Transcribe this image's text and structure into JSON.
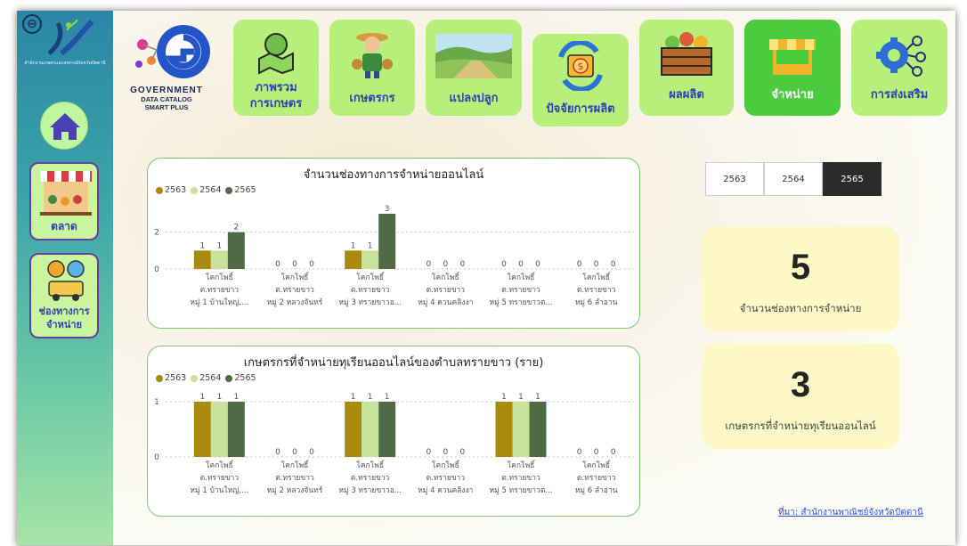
{
  "sidebar": {
    "back_label": "⊖",
    "org_name": "สำนักงานเกษตรและสหกรณ์จังหวัดปัตตานี",
    "items": [
      {
        "label": "ตลาด"
      },
      {
        "label": "ช่องทางการ\nจำหน่าย"
      }
    ]
  },
  "brand": {
    "line1": "GOVERNMENT",
    "line2": "DATA CATALOG",
    "line3": "SMART PLUS"
  },
  "nav": {
    "tiles": [
      {
        "label": "ภาพรวม\nการเกษตร",
        "icon": "farm-map-icon"
      },
      {
        "label": "เกษตรกร",
        "icon": "farmer-icon"
      },
      {
        "label": "แปลงปลูก",
        "icon": "field-icon"
      },
      {
        "label": "ปัจจัยการผลิต",
        "icon": "money-cycle-icon"
      },
      {
        "label": "ผลผลิต",
        "icon": "produce-crate-icon"
      },
      {
        "label": "จำหน่าย",
        "icon": "market-stall-icon",
        "active": true
      },
      {
        "label": "การส่งเสริม",
        "icon": "gear-network-icon"
      }
    ]
  },
  "slicer": {
    "years": [
      "2563",
      "2564",
      "2565"
    ],
    "selected": "2565"
  },
  "kpis": [
    {
      "value": "5",
      "caption": "จำนวนช่องทางการจำหน่าย"
    },
    {
      "value": "3",
      "caption": "เกษตรกรที่จำหน่ายทุเรียนออนไลน์"
    }
  ],
  "source": {
    "prefix": "ที่มา:",
    "text": "สำนักงานพาณิชย์จังหวัดปัตตานี"
  },
  "colors": {
    "s2563": "#a98a0d",
    "s2564": "#c7e29a",
    "s2565": "#4e6b46",
    "nav_tile": "#b6f07a",
    "nav_active": "#4bcb3e",
    "nav_text": "#2d3fb5"
  },
  "chart_data": [
    {
      "type": "bar",
      "title": "จำนวนช่องทางการจำหน่ายออนไลน์",
      "legend": [
        "2563",
        "2564",
        "2565"
      ],
      "yticks": [
        "0",
        "2"
      ],
      "ylim": [
        0,
        3
      ],
      "categories": [
        [
          "โคกโพธิ์",
          "ต.ทรายขาว",
          "หมู่ 1 บ้านใหญ่,..."
        ],
        [
          "โคกโพธิ์",
          "ต.ทรายขาว",
          "หมู่ 2 หลวงจันทร์"
        ],
        [
          "โคกโพธิ์",
          "ต.ทรายขาว",
          "หมู่ 3 ทรายขาวอ..."
        ],
        [
          "โคกโพธิ์",
          "ต.ทรายขาว",
          "หมู่ 4 ควนคลิงงา"
        ],
        [
          "โคกโพธิ์",
          "ต.ทรายขาว",
          "หมู่ 5 ทรายขาวต..."
        ],
        [
          "โคกโพธิ์",
          "ต.ทรายขาว",
          "หมู่ 6 ลำอาน"
        ]
      ],
      "series": [
        {
          "name": "2563",
          "values": [
            1,
            0,
            1,
            0,
            0,
            0
          ]
        },
        {
          "name": "2564",
          "values": [
            1,
            0,
            1,
            0,
            0,
            0
          ]
        },
        {
          "name": "2565",
          "values": [
            2,
            0,
            3,
            0,
            0,
            0
          ]
        }
      ]
    },
    {
      "type": "bar",
      "title": "เกษตรกรที่จำหน่ายทุเรียนออนไลน์ของตำบลทรายขาว (ราย)",
      "legend": [
        "2563",
        "2564",
        "2565"
      ],
      "yticks": [
        "0",
        "1"
      ],
      "ylim": [
        0,
        1
      ],
      "categories": [
        [
          "โคกโพธิ์",
          "ต.ทรายขาว",
          "หมู่ 1 บ้านใหญ่,..."
        ],
        [
          "โคกโพธิ์",
          "ต.ทรายขาว",
          "หมู่ 2 หลวงจันทร์"
        ],
        [
          "โคกโพธิ์",
          "ต.ทรายขาว",
          "หมู่ 3 ทรายขาวอ..."
        ],
        [
          "โคกโพธิ์",
          "ต.ทรายขาว",
          "หมู่ 4 ควนคลิงงา"
        ],
        [
          "โคกโพธิ์",
          "ต.ทรายขาว",
          "หมู่ 5 ทรายขาวต..."
        ],
        [
          "โคกโพธิ์",
          "ต.ทรายขาว",
          "หมู่ 6 ลำอาน"
        ]
      ],
      "series": [
        {
          "name": "2563",
          "values": [
            1,
            0,
            1,
            0,
            1,
            0
          ]
        },
        {
          "name": "2564",
          "values": [
            1,
            0,
            1,
            0,
            1,
            0
          ]
        },
        {
          "name": "2565",
          "values": [
            1,
            0,
            1,
            0,
            1,
            0
          ]
        }
      ]
    }
  ]
}
